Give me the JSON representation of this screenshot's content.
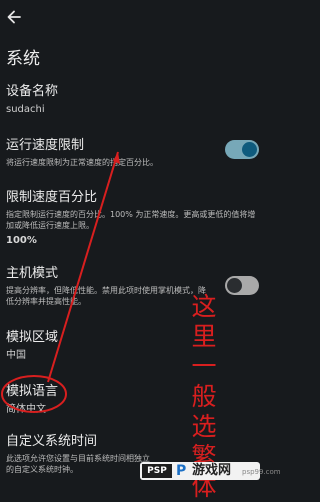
{
  "header": {
    "title": "系统",
    "back_icon": "arrow-left-icon"
  },
  "settings": [
    {
      "label": "设备名称",
      "value": "sudachi"
    },
    {
      "label": "运行速度限制",
      "description": "将运行速度限制为正常速度的指定百分比。",
      "toggle_on": true
    },
    {
      "label": "限制速度百分比",
      "description": "指定限制运行速度的百分比。100% 为正常速度。更高或更低的值将增加或降低运行速度上限。",
      "value": "100%"
    },
    {
      "label": "主机模式",
      "description": "提高分辨率，但降低性能。禁用此项时使用掌机模式，降低分辨率并提高性能。",
      "toggle_on": false
    },
    {
      "label": "模拟区域",
      "value": "中国"
    },
    {
      "label": "模拟语言",
      "value": "简体中文"
    },
    {
      "label": "自定义系统时间",
      "description": "此选项允许您设置与目前系统时间相独立的自定义系统时钟。"
    }
  ],
  "annotation": {
    "text": "这里一般选繁体",
    "color": "#d81f1f"
  },
  "watermark": {
    "logo": "PSP",
    "letter": "P",
    "text": "游戏网",
    "url": "psp99.com"
  },
  "colors": {
    "background": "#171a1d",
    "toggle_on_track": "#77a8b8",
    "toggle_on_knob": "#0f5b7d",
    "annotation": "#d81f1f"
  }
}
